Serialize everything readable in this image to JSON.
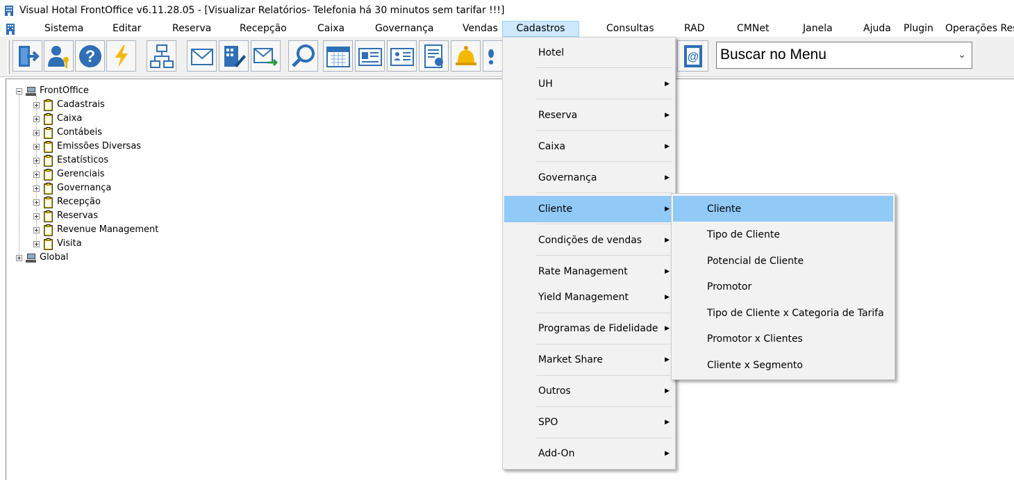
{
  "window": {
    "title": "Visual Hotal FrontOffice v6.11.28.05 - [Visualizar Relatórios- Telefonia há 30 minutos sem tarifar !!!]"
  },
  "menubar": {
    "items": [
      "Sistema",
      "Editar",
      "Reserva",
      "Recepção",
      "Caixa",
      "Governança",
      "Vendas",
      "Cadastros",
      "Consultas",
      "RAD",
      "CMNet",
      "Janela",
      "Ajuda",
      "Plugin",
      "Operações Rese"
    ],
    "active": "Cadastros"
  },
  "toolbar": {
    "buttons": [
      "exit-icon",
      "user-key-icon",
      "help-icon",
      "lightning-icon",
      "network-icon",
      "mail-icon",
      "building-edit-icon",
      "mail-send-icon",
      "search-icon",
      "calendar-icon",
      "card-icon",
      "card-person-icon",
      "checklist-icon",
      "bell-icon",
      "footprints-icon",
      "address-book-icon"
    ],
    "search": {
      "value": "Buscar no Menu"
    }
  },
  "tree": {
    "root": "FrontOffice",
    "children": [
      "Cadastrais",
      "Caixa",
      "Contábeis",
      "Emissões Diversas",
      "Estatísticos",
      "Gerenciais",
      "Governança",
      "Recepção",
      "Reservas",
      "Revenue Management",
      "Visita"
    ],
    "global": "Global"
  },
  "cadastros_menu": {
    "items": [
      {
        "label": "Hotel",
        "submenu": false
      },
      {
        "label": "UH",
        "submenu": true
      },
      {
        "label": "Reserva",
        "submenu": true
      },
      {
        "label": "Caixa",
        "submenu": true
      },
      {
        "label": "Governança",
        "submenu": true
      },
      {
        "label": "Cliente",
        "submenu": true
      },
      {
        "label": "Condições de vendas",
        "submenu": true
      },
      {
        "label": "Rate Management",
        "submenu": true
      },
      {
        "label": "Yield Management",
        "submenu": true
      },
      {
        "label": "Programas de Fidelidade",
        "submenu": true
      },
      {
        "label": "Market Share",
        "submenu": true
      },
      {
        "label": "Outros",
        "submenu": true
      },
      {
        "label": "SPO",
        "submenu": true
      },
      {
        "label": "Add-On",
        "submenu": true
      }
    ],
    "highlighted": "Cliente"
  },
  "cliente_submenu": {
    "items": [
      "Cliente",
      "Tipo de Cliente",
      "Potencial de Cliente",
      "Promotor",
      "Tipo de Cliente x Categoria de Tarifa",
      "Promotor x Clientes",
      "Cliente x Segmento"
    ],
    "highlighted": "Cliente"
  },
  "colors": {
    "highlight": "#91c9f7",
    "menubar_active": "#cde8ff",
    "menu_bg": "#f2f2f2",
    "toolbar_bg": "#f0f0f0"
  }
}
